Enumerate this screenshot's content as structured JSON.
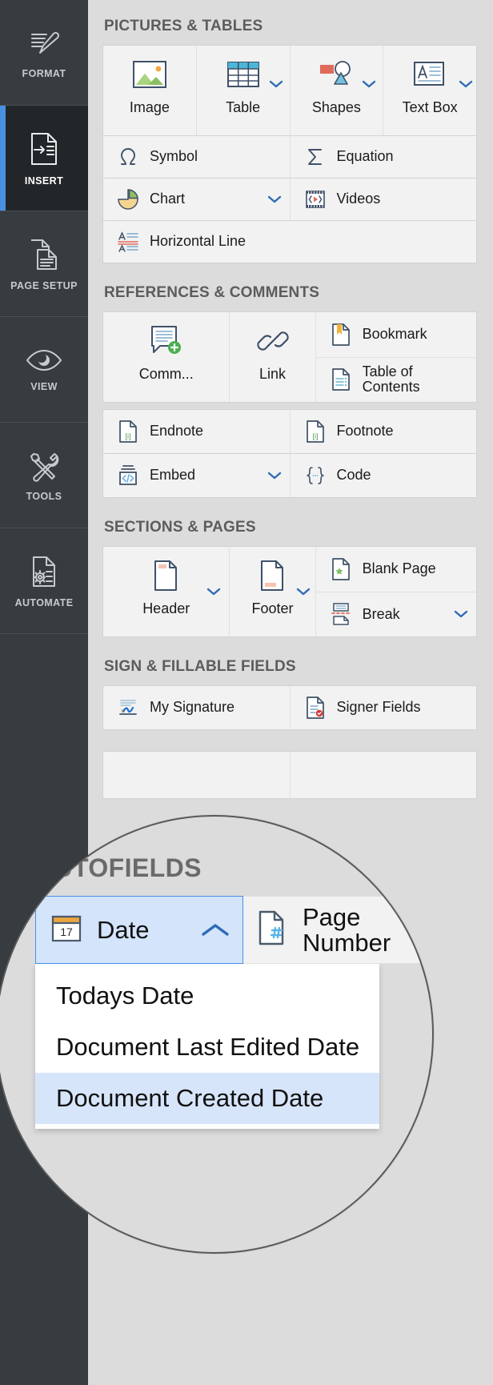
{
  "sidebar": {
    "items": [
      {
        "label": "FORMAT",
        "icon": "brush-format-icon",
        "active": false
      },
      {
        "label": "INSERT",
        "icon": "insert-document-icon",
        "active": true
      },
      {
        "label": "PAGE SETUP",
        "icon": "pages-stack-icon",
        "active": false
      },
      {
        "label": "VIEW",
        "icon": "eye-icon",
        "active": false
      },
      {
        "label": "TOOLS",
        "icon": "wrench-screwdriver-icon",
        "active": false
      },
      {
        "label": "AUTOMATE",
        "icon": "document-gear-icon",
        "active": false
      }
    ]
  },
  "groups": {
    "pictures_tables": {
      "title": "PICTURES & TABLES",
      "tiles": [
        {
          "label": "Image",
          "icon": "image-icon",
          "caret": false
        },
        {
          "label": "Table",
          "icon": "table-icon",
          "caret": true
        },
        {
          "label": "Shapes",
          "icon": "shapes-icon",
          "caret": true
        },
        {
          "label": "Text Box",
          "icon": "text-box-icon",
          "caret": true
        }
      ],
      "rows": [
        [
          {
            "label": "Symbol",
            "icon": "omega-icon",
            "caret": false
          },
          {
            "label": "Equation",
            "icon": "sigma-icon",
            "caret": false
          }
        ],
        [
          {
            "label": "Chart",
            "icon": "pie-chart-icon",
            "caret": true
          },
          {
            "label": "Videos",
            "icon": "film-play-icon",
            "caret": false
          }
        ],
        [
          {
            "label": "Horizontal Line",
            "icon": "horizontal-line-icon",
            "caret": false
          }
        ]
      ]
    },
    "references_comments": {
      "title": "REFERENCES & COMMENTS",
      "tiles": [
        {
          "label": "Comm...",
          "icon": "comment-add-icon",
          "caret": false
        },
        {
          "label": "Link",
          "icon": "link-chain-icon",
          "caret": false
        }
      ],
      "stack": [
        {
          "label": "Bookmark",
          "icon": "bookmark-page-icon",
          "caret": false
        },
        {
          "label": "Table of Contents",
          "icon": "toc-page-icon",
          "caret": false
        }
      ],
      "rows": [
        [
          {
            "label": "Endnote",
            "icon": "endnote-icon",
            "caret": false
          },
          {
            "label": "Footnote",
            "icon": "footnote-icon",
            "caret": false
          }
        ],
        [
          {
            "label": "Embed",
            "icon": "embed-code-icon",
            "caret": true
          },
          {
            "label": "Code",
            "icon": "braces-icon",
            "caret": false
          }
        ]
      ]
    },
    "sections_pages": {
      "title": "SECTIONS & PAGES",
      "tiles": [
        {
          "label": "Header",
          "icon": "header-page-icon",
          "caret": true
        },
        {
          "label": "Footer",
          "icon": "footer-page-icon",
          "caret": true
        }
      ],
      "stack": [
        {
          "label": "Blank Page",
          "icon": "blank-page-icon",
          "caret": false
        },
        {
          "label": "Break",
          "icon": "page-break-icon",
          "caret": true
        }
      ]
    },
    "sign_fillable": {
      "title": "SIGN & FILLABLE FIELDS",
      "rows": [
        [
          {
            "label": "My Signature",
            "icon": "signature-icon",
            "caret": false
          },
          {
            "label": "Signer Fields",
            "icon": "signer-fields-icon",
            "caret": false
          }
        ]
      ]
    }
  },
  "magnifier": {
    "title": "AUTOFIELDS",
    "date_button": {
      "label": "Date",
      "icon": "calendar-17-icon",
      "caret": "chevron-up-icon",
      "state": "open"
    },
    "page_number_button": {
      "label": "Page Number",
      "icon": "page-number-icon",
      "caret": "chevron-down-icon"
    },
    "dropdown_options": [
      {
        "label": "Todays Date",
        "highlighted": false
      },
      {
        "label": "Document Last Edited Date",
        "highlighted": false
      },
      {
        "label": "Document Created Date",
        "highlighted": true
      }
    ]
  },
  "colors": {
    "accent": "#4a90e2",
    "rail_bg": "#373c41",
    "rail_active_bg": "#232629",
    "panel_bg": "#dcdcdc",
    "tile_bg": "#f2f2f2",
    "highlight": "#d7e5fb"
  }
}
